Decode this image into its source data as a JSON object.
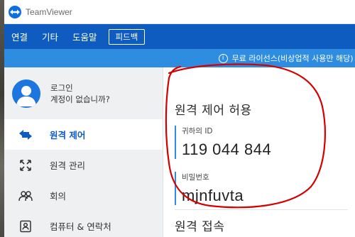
{
  "window": {
    "title": "TeamViewer"
  },
  "menu": {
    "items": [
      "연결",
      "기타",
      "도움말"
    ],
    "feedback": "피드백"
  },
  "license_banner": {
    "text": "무료 라이선스(비상업적 사용만 해당) - MinYo",
    "icon": "info-icon"
  },
  "account": {
    "login": "로그인",
    "no_account": "계정이 없습니까?"
  },
  "nav": {
    "items": [
      {
        "label": "원격 제어",
        "icon": "arrows-swap-icon",
        "active": true
      },
      {
        "label": "원격 관리",
        "icon": "expand-arrows-icon",
        "active": false
      },
      {
        "label": "회의",
        "icon": "people-icon",
        "active": false
      },
      {
        "label": "컴퓨터 & 연락처",
        "icon": "contact-card-icon",
        "active": false
      }
    ]
  },
  "remote_control": {
    "title": "원격 제어 허용",
    "id_label": "귀하의 ID",
    "id_value": "119 044 844",
    "password_label": "비밀번호",
    "password_value": "mjnfuvta"
  },
  "remote_access": {
    "title": "원격 접속"
  },
  "colors": {
    "menubar": "#0e5cbf",
    "banner": "#2e8de0",
    "accent": "#0e5cbf",
    "annotation": "#d40000"
  }
}
